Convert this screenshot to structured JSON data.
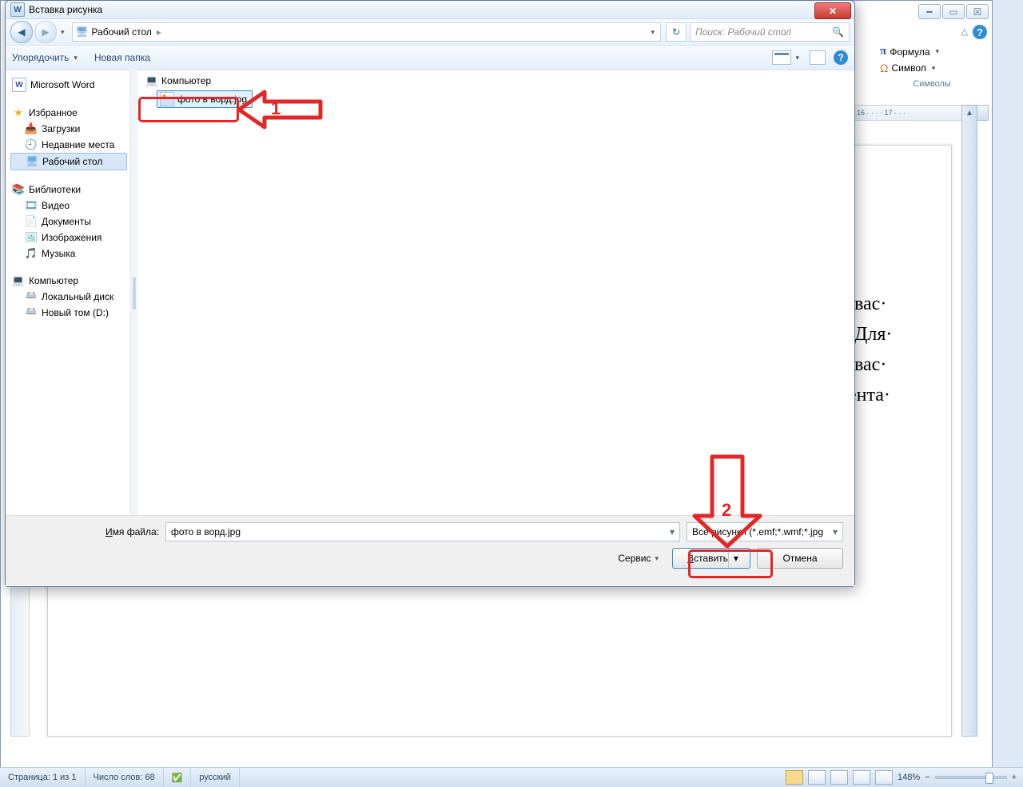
{
  "dialog": {
    "title": "Вставка рисунка",
    "nav": {
      "location": "Рабочий стол",
      "crumb_sep": "▸",
      "search_placeholder": "Поиск: Рабочий стол"
    },
    "toolbar": {
      "organize": "Упорядочить",
      "new_folder": "Новая папка"
    },
    "nav_pane": {
      "word": "Microsoft Word",
      "favorites": "Избранное",
      "downloads": "Загрузки",
      "recent": "Недавние места",
      "desktop": "Рабочий стол",
      "libraries": "Библиотеки",
      "video": "Видео",
      "documents": "Документы",
      "pictures": "Изображения",
      "music": "Музыка",
      "computer": "Компьютер",
      "local_disk": "Локальный диск",
      "volume_d": "Новый том (D:)"
    },
    "file_area": {
      "parent": "Компьютер",
      "selected_file": "фото в ворд.jpg"
    },
    "footer": {
      "filename_label_p1": "И",
      "filename_label_p2": "мя файла:",
      "filename_value": "фото в ворд.jpg",
      "filter_text": "Все рисунки (*.emf;*.wmf;*.jpg",
      "service": "Сервис",
      "insert_u": "В",
      "insert_rest": "ставить",
      "cancel": "Отмена"
    }
  },
  "annotations": {
    "n1": "1",
    "n2": "2"
  },
  "ribbon": {
    "formula": "Формула",
    "symbol": "Символ",
    "group": "Символы"
  },
  "ruler_fragment": "16 · · · · 17 · · ·",
  "doc_lines": [
    "·вас·",
    "·Для·",
    "·вас·",
    "",
    "ента·"
  ],
  "status": {
    "page": "Страница: 1 из 1",
    "words": "Число слов: 68",
    "lang": "русский",
    "zoom": "148%"
  }
}
